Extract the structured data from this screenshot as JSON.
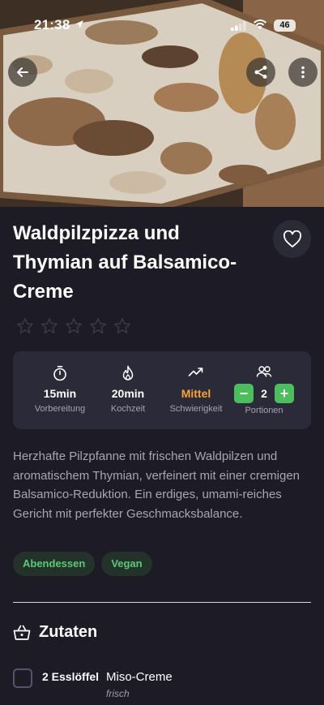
{
  "status_bar": {
    "time": "21:38",
    "battery": "46"
  },
  "recipe": {
    "title": "Waldpilzpizza und Thymian auf Balsamico-Creme",
    "rating": 0,
    "rating_max": 5,
    "description": "Herzhafte Pilzpfanne mit frischen Waldpilzen und aromatischem Thymian, verfeinert mit einer cremigen Balsamico-Reduktion. Ein erdiges, umami-reiches Gericht mit perfekter Geschmacksbalance.",
    "info": {
      "prep_time": {
        "value": "15min",
        "label": "Vorbereitung",
        "icon": "stopwatch-icon"
      },
      "cook_time": {
        "value": "20min",
        "label": "Kochzeit",
        "icon": "flame-icon"
      },
      "difficulty": {
        "value": "Mittel",
        "label": "Schwierigkeit",
        "icon": "trending-up-icon",
        "color": "#f5a33a"
      },
      "portions": {
        "value": "2",
        "label": "Portionen",
        "icon": "people-icon",
        "minus": "−",
        "plus": "+",
        "button_color": "#4bbf5e"
      }
    },
    "tags": [
      "Abendessen",
      "Vegan"
    ]
  },
  "ingredients": {
    "title": "Zutaten",
    "icon": "basket-icon",
    "items": [
      {
        "amount": "2 Esslöffel",
        "name": "Miso-Creme",
        "note": "frisch"
      }
    ]
  },
  "colors": {
    "background": "#1c1b26",
    "card": "#2b2a38",
    "accent_green": "#4bbf5e",
    "tag_text": "#5cc879"
  }
}
